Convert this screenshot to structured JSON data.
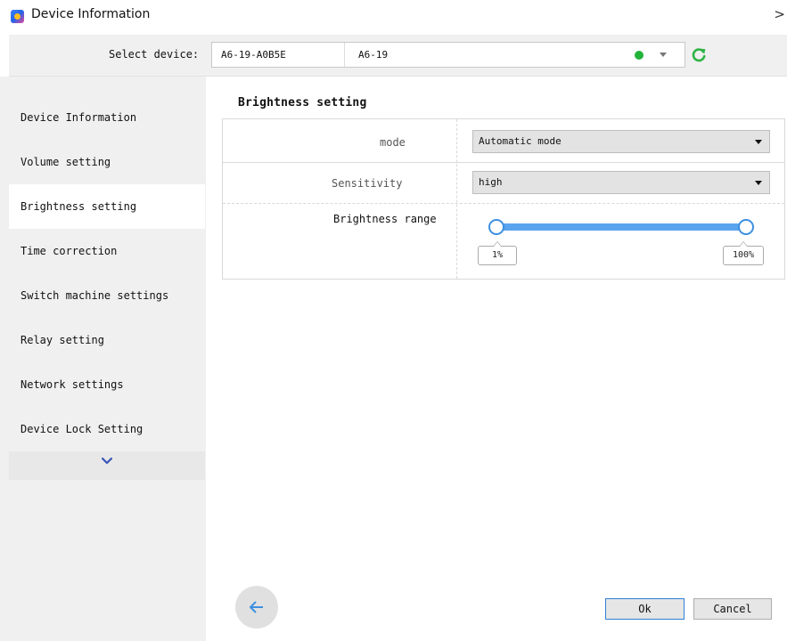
{
  "window": {
    "title": "Device Information",
    "close_glyph": ">"
  },
  "device_bar": {
    "label": "Select device:",
    "device_id": "A6-19-A0B5E",
    "device_name": "A6-19",
    "status_color": "#22b33a",
    "refresh_icon": "refresh-icon"
  },
  "sidebar": {
    "items": [
      {
        "label": "Device Information",
        "active": false
      },
      {
        "label": "Volume setting",
        "active": false
      },
      {
        "label": "Brightness setting",
        "active": true
      },
      {
        "label": "Time correction",
        "active": false
      },
      {
        "label": "Switch machine settings",
        "active": false
      },
      {
        "label": "Relay setting",
        "active": false
      },
      {
        "label": "Network settings",
        "active": false
      },
      {
        "label": "Device Lock Setting",
        "active": false
      }
    ],
    "more_icon": "chevron-down-icon"
  },
  "main": {
    "section_title": "Brightness setting",
    "mode": {
      "label": "mode",
      "value": "Automatic mode"
    },
    "sensitivity": {
      "label": "Sensitivity",
      "value": "high"
    },
    "brightness_range": {
      "label": "Brightness range",
      "min_label": "1%",
      "max_label": "100%",
      "min_value": 1,
      "max_value": 100
    }
  },
  "footer": {
    "back_icon": "arrow-left-icon",
    "ok_label": "Ok",
    "cancel_label": "Cancel"
  },
  "colors": {
    "accent": "#3d8fe0",
    "slider_fill": "#5aa3ee",
    "status_online": "#22b33a",
    "refresh": "#2fb344"
  }
}
